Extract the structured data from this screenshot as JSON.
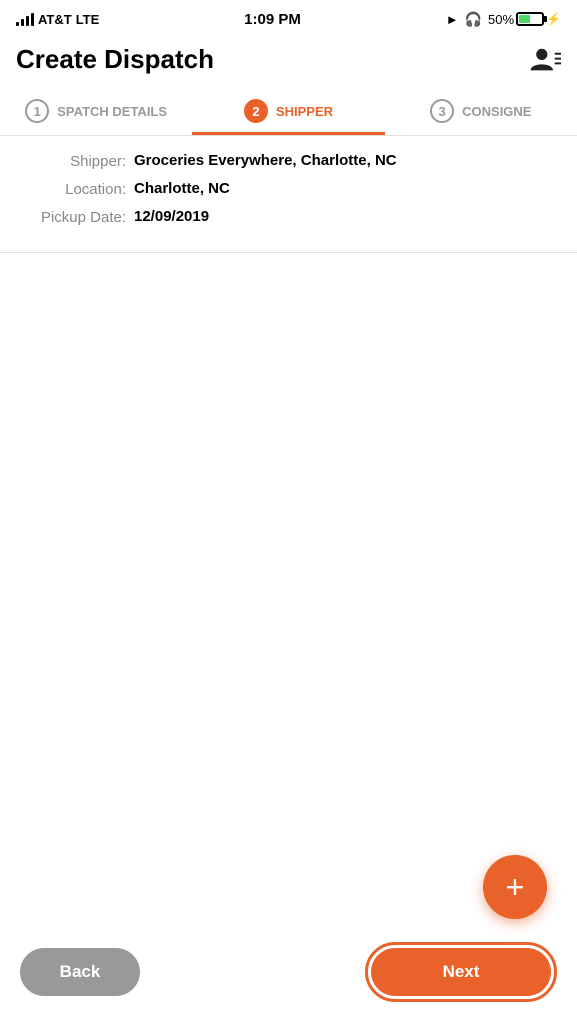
{
  "statusBar": {
    "carrier": "AT&T",
    "network": "LTE",
    "time": "1:09 PM",
    "battery": "50%"
  },
  "header": {
    "title": "Create Dispatch",
    "userIcon": "user-menu-icon"
  },
  "steps": [
    {
      "id": 1,
      "label": "SPATCH DETAILS",
      "state": "past"
    },
    {
      "id": 2,
      "label": "SHIPPER",
      "state": "active"
    },
    {
      "id": 3,
      "label": "CONSIGNE",
      "state": "inactive"
    }
  ],
  "shipper": {
    "shipperLabel": "Shipper:",
    "shipperValue": "Groceries Everywhere, Charlotte, NC",
    "locationLabel": "Location:",
    "locationValue": "Charlotte, NC",
    "pickupDateLabel": "Pickup Date:",
    "pickupDateValue": "12/09/2019"
  },
  "fab": {
    "icon": "plus-icon",
    "label": "+"
  },
  "buttons": {
    "back": "Back",
    "next": "Next"
  }
}
